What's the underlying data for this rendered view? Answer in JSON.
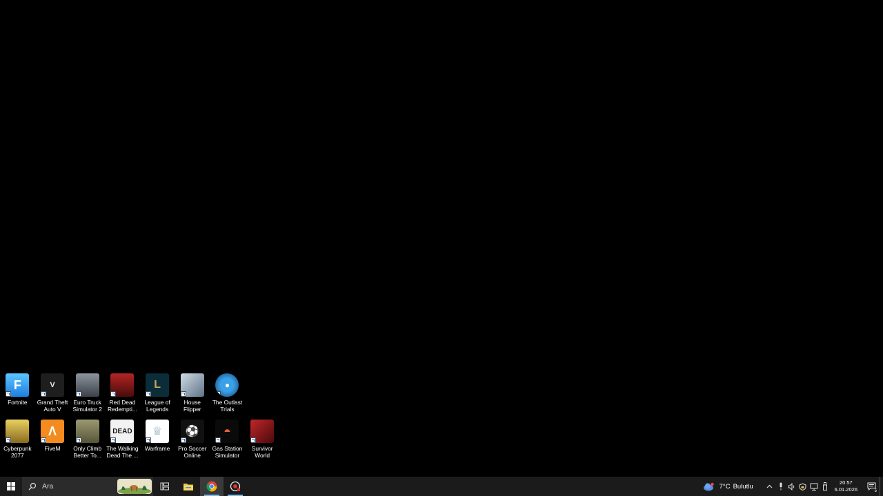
{
  "desktop": {
    "icons_row1": [
      {
        "label": "Fortnite",
        "icon": "fortnite-icon",
        "color": "#3fa7f5"
      },
      {
        "label": "Grand Theft\nAuto V",
        "icon": "gta-v-icon",
        "color": "#2a2a2a"
      },
      {
        "label": "Euro Truck\nSimulator 2",
        "icon": "euro-truck-icon",
        "color": "#555a62"
      },
      {
        "label": "Red Dead\nRedempti...",
        "icon": "red-dead-icon",
        "color": "#8e1b1b"
      },
      {
        "label": "League of\nLegends",
        "icon": "league-icon",
        "color": "#0b2d3a"
      },
      {
        "label": "House\nFlipper",
        "icon": "house-flipper-icon",
        "color": "#9fb0c0"
      },
      {
        "label": "The Outlast\nTrials",
        "icon": "outlast-icon",
        "color": "#1d7cc0"
      }
    ],
    "icons_row2": [
      {
        "label": "Cyberpunk\n2077",
        "icon": "cyberpunk-icon",
        "color": "#d6b64a"
      },
      {
        "label": "FiveM",
        "icon": "fivem-icon",
        "color": "#f38b1e"
      },
      {
        "label": "Only Climb\nBetter To...",
        "icon": "only-climb-icon",
        "color": "#7b7a58"
      },
      {
        "label": "The Walking\nDead The ...",
        "icon": "walking-dead-icon",
        "color": "#ffffff"
      },
      {
        "label": "Warframe",
        "icon": "warframe-icon",
        "color": "#ffffff"
      },
      {
        "label": "Pro Soccer\nOnline",
        "icon": "pro-soccer-icon",
        "color": "#111111"
      },
      {
        "label": "Gas Station\nSimulator",
        "icon": "gas-station-icon",
        "color": "#c8501e"
      },
      {
        "label": "Survivor\nWorld",
        "icon": "survivor-world-icon",
        "color": "#9b1c20"
      }
    ]
  },
  "taskbar": {
    "search_placeholder": "Ara",
    "weather": {
      "temp": "7°C",
      "condition": "Bulutlu"
    },
    "clock": {
      "time": "20:57",
      "date": "6.01.2026"
    },
    "notification_count": "5",
    "apps": [
      {
        "icon": "task-view-icon"
      },
      {
        "icon": "file-explorer-icon"
      },
      {
        "icon": "chrome-icon"
      },
      {
        "icon": "recorder-icon"
      }
    ]
  },
  "colors": {
    "desktop_bg": "#000000",
    "taskbar_bg": "#1b1b1b",
    "search_bg": "#2b2b2b",
    "accent": "#76b9ed"
  }
}
